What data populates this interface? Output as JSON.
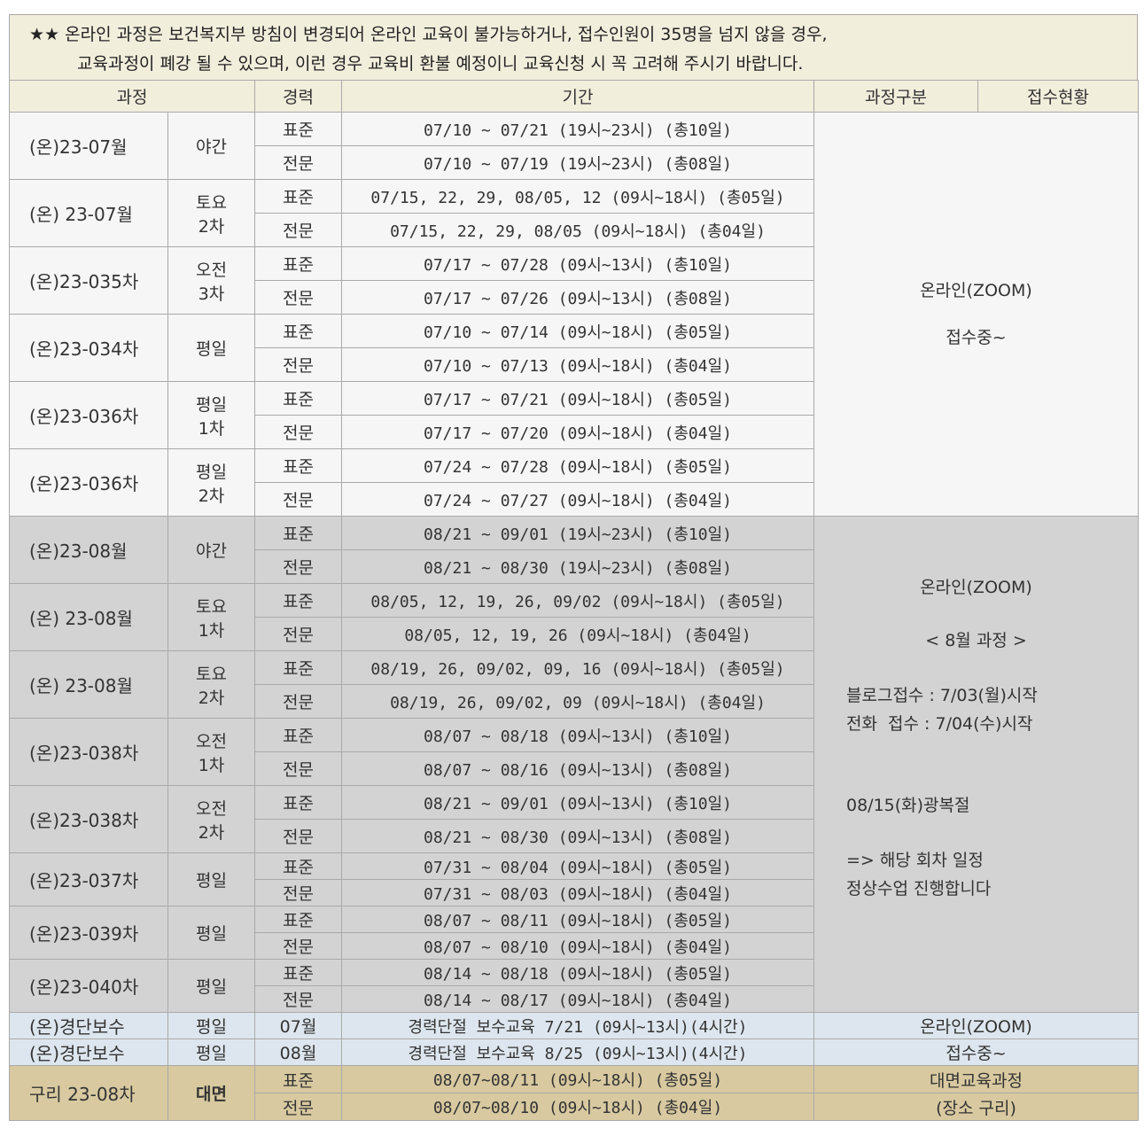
{
  "notice": {
    "line1": "★★ 온라인 과정은 보건복지부 방침이 변경되어 온라인 교육이 불가능하거나, 접수인원이 35명을 넘지 않을 경우,",
    "line2": "교육과정이 폐강 될 수 있으며, 이런 경우 교육비 환불 예정이니 교육신청 시 꼭 고려해 주시기 바랍니다."
  },
  "headers": {
    "course": "과정",
    "career": "경력",
    "period": "기간",
    "category": "과정구분",
    "status": "접수현황"
  },
  "label_standard": "표준",
  "label_expert": "전문",
  "july": {
    "courses": [
      {
        "name": "(온)23-07월",
        "sub": "야간",
        "p1": "07/10 ~ 07/21 (19시~23시) (총10일)",
        "p2": "07/10 ~ 07/19 (19시~23시) (총08일)"
      },
      {
        "name": "(온) 23-07월",
        "sub": "토요 2차",
        "p1": "07/15, 22, 29, 08/05, 12 (09시~18시) (총05일)",
        "p2": "07/15, 22, 29, 08/05      (09시~18시) (총04일)"
      },
      {
        "name": "(온)23-035차",
        "sub": "오전 3차",
        "p1": "07/17 ~ 07/28 (09시~13시) (총10일)",
        "p2": "07/17 ~ 07/26 (09시~13시) (총08일)"
      },
      {
        "name": "(온)23-034차",
        "sub": "평일",
        "p1": "07/10 ~ 07/14 (09시~18시) (총05일)",
        "p2": "07/10 ~ 07/13 (09시~18시) (총04일)"
      },
      {
        "name": "(온)23-036차",
        "sub": "평일 1차",
        "p1": "07/17 ~ 07/21 (09시~18시) (총05일)",
        "p2": "07/17 ~ 07/20 (09시~18시) (총04일)"
      },
      {
        "name": "(온)23-036차",
        "sub": "평일 2차",
        "p1": "07/24 ~ 07/28 (09시~18시) (총05일)",
        "p2": "07/24 ~ 07/27 (09시~18시) (총04일)"
      }
    ],
    "category_line1": "온라인(ZOOM)",
    "category_line2": "접수중~"
  },
  "august": {
    "courses": [
      {
        "name": "(온)23-08월",
        "sub": "야간",
        "p1": "08/21 ~ 09/01 (19시~23시) (총10일)",
        "p2": "08/21 ~ 08/30 (19시~23시) (총08일)"
      },
      {
        "name": "(온) 23-08월",
        "sub": "토요 1차",
        "p1": "08/05, 12, 19, 26, 09/02 (09시~18시) (총05일)",
        "p2": "08/05, 12, 19, 26      (09시~18시) (총04일)"
      },
      {
        "name": "(온) 23-08월",
        "sub": "토요 2차",
        "p1": "08/19, 26, 09/02, 09, 16 (09시~18시) (총05일)",
        "p2": "08/19, 26, 09/02, 09    (09시~18시) (총04일)"
      },
      {
        "name": "(온)23-038차",
        "sub": "오전 1차",
        "p1": "08/07 ~ 08/18 (09시~13시) (총10일)",
        "p2": "08/07 ~ 08/16 (09시~13시) (총08일)"
      },
      {
        "name": "(온)23-038차",
        "sub": "오전 2차",
        "p1": "08/21 ~ 09/01 (09시~13시) (총10일)",
        "p2": "08/21 ~ 08/30 (09시~13시) (총08일)"
      },
      {
        "name": "(온)23-037차",
        "sub": "평일",
        "p1": "07/31 ~ 08/04 (09시~18시) (총05일)",
        "p2": "07/31 ~ 08/03 (09시~18시) (총04일)"
      },
      {
        "name": "(온)23-039차",
        "sub": "평일",
        "p1": "08/07 ~ 08/11 (09시~18시) (총05일)",
        "p2": "08/07 ~ 08/10 (09시~18시) (총04일)"
      },
      {
        "name": "(온)23-040차",
        "sub": "평일",
        "p1": "08/14 ~ 08/18 (09시~18시) (총05일)",
        "p2": "08/14 ~ 08/17 (09시~18시) (총04일)"
      }
    ],
    "category": {
      "title": "온라인(ZOOM)",
      "month": "< 8월 과정 >",
      "blog": "블로그접수 : 7/03(월)시작",
      "phone": "전화  접수 : 7/04(수)시작",
      "holiday": "08/15(화)광복절",
      "note1": "=> 해당 회차 일정",
      "note2": "정상수업 진행합니다"
    }
  },
  "refresher": {
    "rows": [
      {
        "name": "(온)경단보수",
        "sub": "평일",
        "career": "07월",
        "period": "경력단절 보수교육 7/21 (09시~13시)(4시간)"
      },
      {
        "name": "(온)경단보수",
        "sub": "평일",
        "career": "08월",
        "period": "경력단절 보수교육 8/25 (09시~13시)(4시간)"
      }
    ],
    "category_line1": "온라인(ZOOM)",
    "category_line2": "접수중~"
  },
  "offline": {
    "name": "구리 23-08차",
    "sub": "대면",
    "p1": "08/07~08/11 (09시~18시) (총05일)",
    "p2": "08/07~08/10 (09시~18시) (총04일)",
    "category_line1": "대면교육과정",
    "category_line2": "(장소 구리)"
  }
}
